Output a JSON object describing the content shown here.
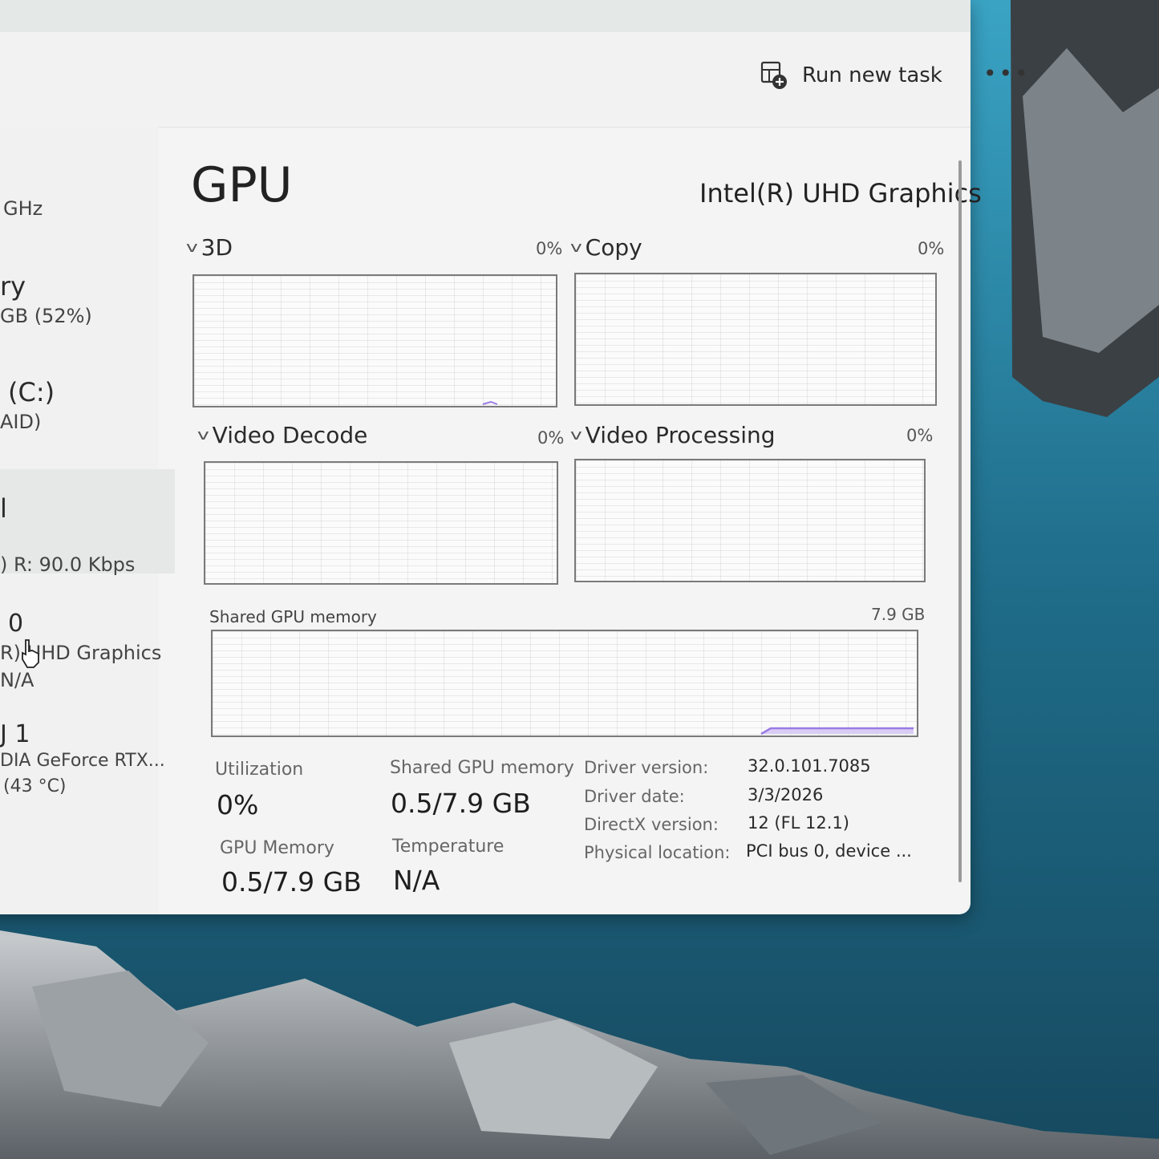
{
  "colors": {
    "window_bg": "#f3f4f3",
    "accent_purple": "#9b7be6",
    "graph_border": "#7a7a7a",
    "desktop_water": "#2c6f86"
  },
  "command_bar": {
    "run_new_task_label": "Run new task",
    "run_new_task_icon": "run-task-icon",
    "more_label": "•••"
  },
  "sidebar": {
    "cpu_speed_fragment": "GHz",
    "memory_title_fragment": "ry",
    "memory_value_fragment": "GB (52%)",
    "disk_title_fragment": "(C:)",
    "disk_sub_fragment": "AID)",
    "network_title_fragment": "l",
    "network_value_fragment": ") R: 90.0 Kbps",
    "gpu0_title_fragment": "0",
    "gpu0_name_fragment": "R) UHD Graphics",
    "gpu0_value_fragment": "N/A",
    "gpu1_title_fragment": "J 1",
    "gpu1_name_fragment": "DIA GeForce RTX...",
    "gpu1_value_fragment": "(43 °C)"
  },
  "main": {
    "title": "GPU",
    "device_name": "Intel(R) UHD Graphics",
    "engines": [
      {
        "label": "3D",
        "percent": "0%"
      },
      {
        "label": "Copy",
        "percent": "0%"
      },
      {
        "label": "Video Decode",
        "percent": "0%"
      },
      {
        "label": "Video Processing",
        "percent": "0%"
      }
    ],
    "shared_memory_graph": {
      "label": "Shared GPU memory",
      "max": "7.9 GB"
    },
    "stats": {
      "utilization_label": "Utilization",
      "utilization_value": "0%",
      "shared_label": "Shared GPU memory",
      "shared_value": "0.5/7.9 GB",
      "gpu_memory_label": "GPU Memory",
      "gpu_memory_value": "0.5/7.9 GB",
      "temperature_label": "Temperature",
      "temperature_value": "N/A"
    },
    "properties": [
      {
        "label": "Driver version:",
        "value": "32.0.101.7085"
      },
      {
        "label": "Driver date:",
        "value": "3/3/2026"
      },
      {
        "label": "DirectX version:",
        "value": "12 (FL 12.1)"
      },
      {
        "label": "Physical location:",
        "value": "PCI bus 0, device ..."
      }
    ]
  }
}
